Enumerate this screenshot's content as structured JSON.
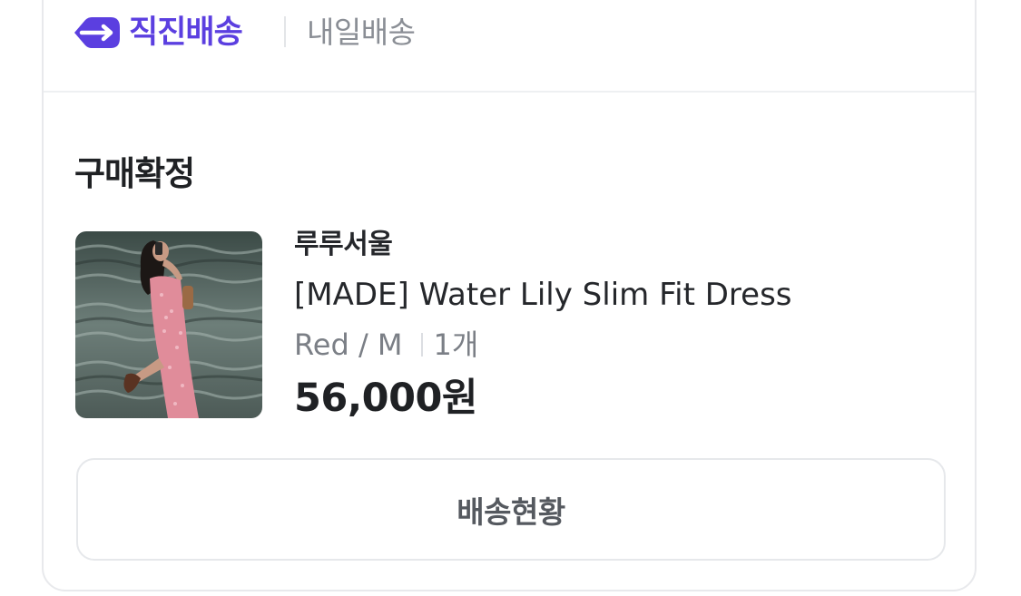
{
  "header": {
    "brand_label": "직진배송",
    "sub_label": "내일배송",
    "brand_color": "#5b3fe0"
  },
  "order": {
    "status": "구매확정",
    "item": {
      "image_alt": "Woman in a pink slim fit dress standing in front of water",
      "seller": "루루서울",
      "product_name": "[MADE] Water Lily Slim Fit Dress",
      "option": "Red / M",
      "quantity": "1개",
      "price": "56,000원"
    },
    "track_button_label": "배송현황"
  },
  "icons": {
    "brand": "delivery-arrow-icon"
  }
}
